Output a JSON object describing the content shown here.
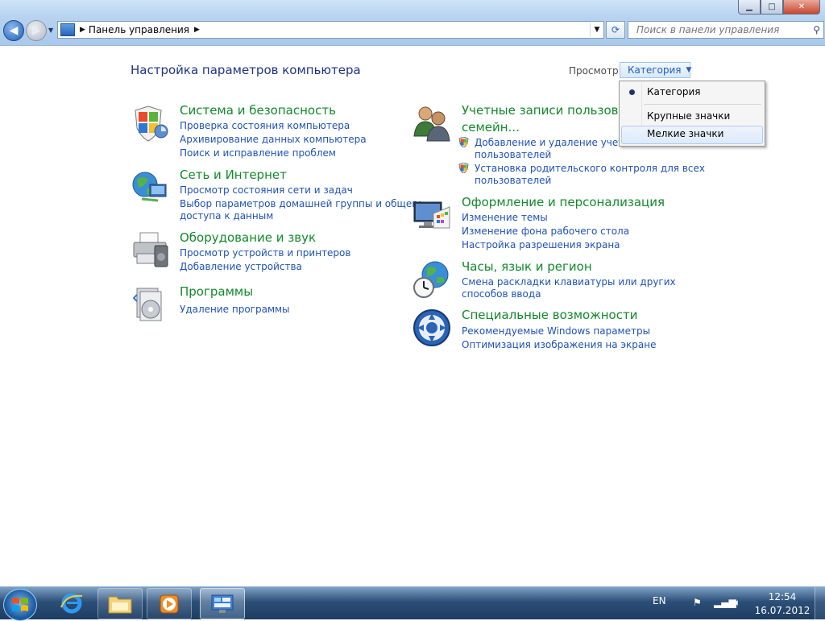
{
  "window": {
    "minimize": "▁",
    "maximize": "□",
    "close": "✕"
  },
  "address_bar": {
    "breadcrumb": "Панель управления",
    "search_placeholder": "Поиск в панели управления"
  },
  "page": {
    "title": "Настройка параметров компьютера",
    "view_label": "Просмотр:",
    "view_value": "Категория"
  },
  "view_menu": {
    "items": [
      "Категория",
      "Крупные значки",
      "Мелкие значки"
    ],
    "selected": "Категория",
    "highlighted": "Мелкие значки"
  },
  "categories": [
    {
      "title": "Система и безопасность",
      "icon": "shield-icon",
      "links": [
        "Проверка состояния компьютера",
        "Архивирование данных компьютера",
        "Поиск и исправление проблем"
      ]
    },
    {
      "title": "Сеть и Интернет",
      "icon": "network-globe-icon",
      "links": [
        "Просмотр состояния сети и задач",
        "Выбор параметров домашней группы и общего",
        "доступа к данным"
      ]
    },
    {
      "title": "Оборудование и звук",
      "icon": "printer-icon",
      "links": [
        "Просмотр устройств и принтеров",
        "Добавление устройства"
      ]
    },
    {
      "title": "Программы",
      "icon": "programs-icon",
      "links": [
        "Удаление программы"
      ]
    },
    {
      "title_line1": "Учетные записи пользовате",
      "title_line2": "семейн...",
      "icon": "users-icon",
      "links": [
        "Добавление и удаление учетных записей",
        "пользователей",
        "Установка родительского контроля для всех",
        "пользователей"
      ]
    },
    {
      "title": "Оформление и персонализация",
      "icon": "display-icon",
      "links": [
        "Изменение темы",
        "Изменение фона рабочего стола",
        "Настройка разрешения экрана"
      ]
    },
    {
      "title": "Часы, язык и регион",
      "icon": "clock-globe-icon",
      "links": [
        "Смена раскладки клавиатуры или других",
        "способов ввода"
      ]
    },
    {
      "title": "Специальные возможности",
      "icon": "accessibility-icon",
      "links": [
        "Рекомендуемые Windows параметры",
        "Оптимизация изображения на экране"
      ]
    }
  ],
  "taskbar": {
    "language": "EN",
    "time": "12:54",
    "date": "16.07.2012"
  }
}
